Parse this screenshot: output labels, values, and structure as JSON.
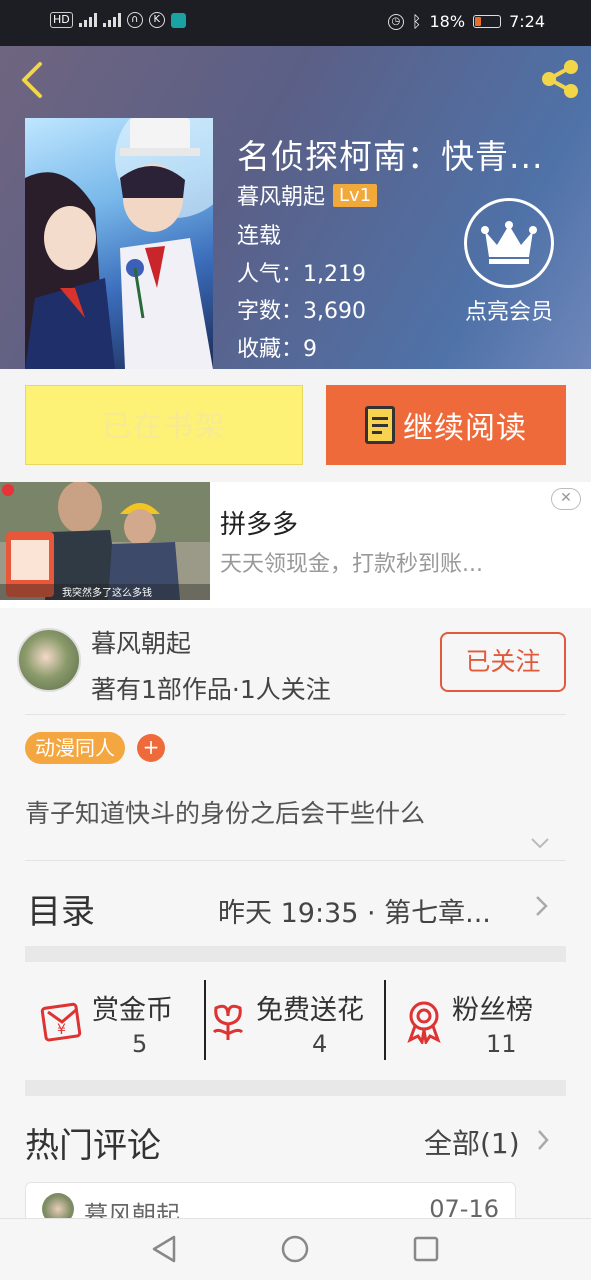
{
  "status_bar": {
    "left_chips": [
      "HD",
      "4G",
      "4G"
    ],
    "battery": "18%",
    "time": "7:24"
  },
  "book": {
    "title": "名侦探柯南：快青...",
    "author": "暮风朝起",
    "level": "Lv1",
    "status": "连载",
    "popularity_label": "人气：",
    "popularity": "1,219",
    "words_label": "字数：",
    "words": "3,690",
    "favorites_label": "收藏：",
    "favorites": "9",
    "vip_label": "点亮会员"
  },
  "actions": {
    "shelf_label": "已在书架",
    "read_label": "继续阅读"
  },
  "ad": {
    "title": "拼多多",
    "subtitle": "天天领现金，打款秒到账...",
    "close": "✕",
    "caption": "我突然多了这么多钱"
  },
  "author_card": {
    "name": "暮风朝起",
    "meta": "著有1部作品·1人关注",
    "follow_label": "已关注"
  },
  "tags": [
    "动漫同人"
  ],
  "tag_add": "+",
  "description": "青子知道快斗的身份之后会干些什么",
  "toc": {
    "label": "目录",
    "info": "昨天 19:35 · 第七章..."
  },
  "stats": [
    {
      "label": "赏金币",
      "value": "5",
      "icon": "coin-envelope-icon"
    },
    {
      "label": "免费送花",
      "value": "4",
      "icon": "flower-icon"
    },
    {
      "label": "粉丝榜",
      "value": "11",
      "icon": "medal-icon"
    }
  ],
  "comments": {
    "title": "热门评论",
    "all_label": "全部(1)",
    "items": [
      {
        "name": "暮风朝起",
        "date": "07-16"
      }
    ]
  },
  "colors": {
    "accent": "#ee6a3a",
    "tag": "#f4a640",
    "shelf": "#fdf176"
  }
}
